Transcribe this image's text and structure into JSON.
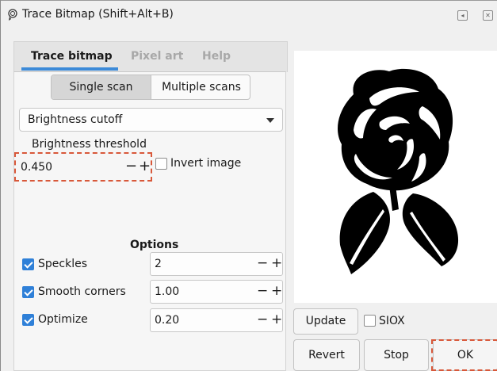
{
  "window": {
    "title": "Trace Bitmap (Shift+Alt+B)",
    "title_icon": "trace-bitmap-icon",
    "controls": [
      "minimize-icon",
      "close-icon"
    ]
  },
  "tabs": [
    {
      "label": "Trace bitmap",
      "active": true
    },
    {
      "label": "Pixel art",
      "active": false
    },
    {
      "label": "Help",
      "active": false
    }
  ],
  "scan_mode": {
    "options": [
      "Single scan",
      "Multiple scans"
    ],
    "selected": "Single scan"
  },
  "mode_select": {
    "value": "Brightness cutoff"
  },
  "threshold": {
    "label": "Brightness threshold",
    "value": "0.450",
    "minus": "−",
    "plus": "+"
  },
  "invert": {
    "label": "Invert image",
    "checked": false
  },
  "options": {
    "header": "Options",
    "rows": [
      {
        "label": "Speckles",
        "checked": true,
        "value": "2"
      },
      {
        "label": "Smooth corners",
        "checked": true,
        "value": "1.00"
      },
      {
        "label": "Optimize",
        "checked": true,
        "value": "0.20"
      }
    ],
    "minus": "−",
    "plus": "+"
  },
  "preview": {
    "image": "black rose silhouette"
  },
  "actions": {
    "update": "Update",
    "siox": "SIOX",
    "siox_checked": false,
    "revert": "Revert",
    "stop": "Stop",
    "ok": "OK"
  },
  "colors": {
    "accent": "#3c8ad8",
    "checkbox": "#2f80d8",
    "highlight": "#d8583a"
  }
}
